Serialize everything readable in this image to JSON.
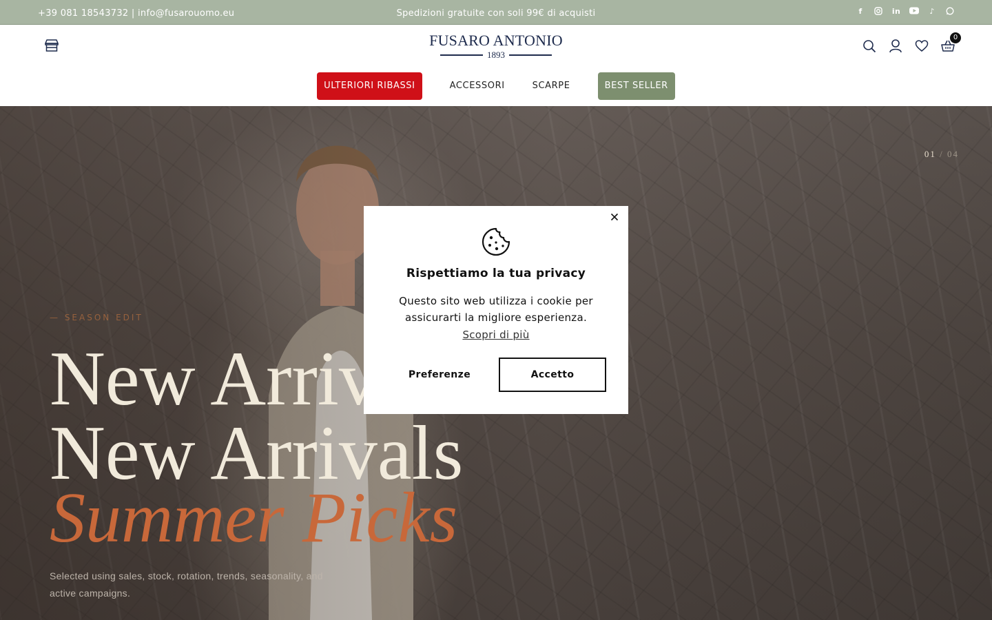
{
  "topbar": {
    "contact": "+39 081 18543732 | info@fusarouomo.eu",
    "promo": "Spedizioni gratuite con soli 99€ di acquisti",
    "socials": [
      "facebook-icon",
      "instagram-icon",
      "linkedin-icon",
      "youtube-icon",
      "tiktok-icon",
      "whatsapp-icon"
    ]
  },
  "header": {
    "logo_name": "FUSARO ANTONIO",
    "logo_year": "1893",
    "cart_count": "0",
    "icons": [
      "store-icon",
      "search-icon",
      "user-icon",
      "heart-icon",
      "basket-icon"
    ]
  },
  "nav": {
    "items": [
      "ULTERIORI RIBASSI",
      "ACCESSORI",
      "SCARPE",
      "BEST SELLER"
    ]
  },
  "colors": {
    "topbar": "#a8b5a2",
    "promo_red": "#cf1018",
    "best_green": "#7d8f6f",
    "logo_navy": "#1d2a4c",
    "hero_accent": "#c8683a"
  },
  "hero": {
    "counter_current": "01",
    "counter_sep": "/",
    "counter_total": "04",
    "eyebrow": "— SEASON EDIT",
    "title_line1": "New Arrivals",
    "title_line2": "New Arrivals",
    "title_line3": "Summer Picks",
    "description": "Selected using sales, stock, rotation, trends, seasonality, and active campaigns."
  },
  "cookie": {
    "close_icon": "close-icon",
    "cookie_icon": "cookie-icon",
    "title": "Rispettiamo la tua privacy",
    "text": "Questo sito web utilizza i cookie per assicurarti la migliore esperienza.",
    "more_link": "Scopri di più",
    "preferences_button": "Preferenze",
    "accept_button": "Accetto"
  }
}
